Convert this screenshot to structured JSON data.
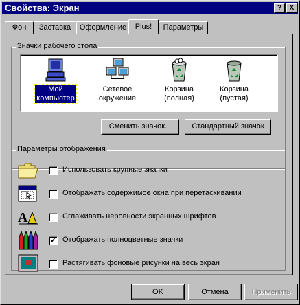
{
  "window": {
    "title": "Свойства: Экран",
    "help_label": "?",
    "close_label": "X"
  },
  "tabs": [
    {
      "label": "Фон"
    },
    {
      "label": "Заставка"
    },
    {
      "label": "Оформление"
    },
    {
      "label": "Plus!"
    },
    {
      "label": "Параметры"
    }
  ],
  "active_tab": "Plus!",
  "desktop_icons": {
    "legend": "Значки рабочего стола",
    "items": [
      {
        "line1": "Мой",
        "line2": "компьютер",
        "icon": "my-computer-icon",
        "selected": true
      },
      {
        "line1": "Сетевое",
        "line2": "окружение",
        "icon": "network-neighborhood-icon",
        "selected": false
      },
      {
        "line1": "Корзина",
        "line2": "(полная)",
        "icon": "recycle-bin-full-icon",
        "selected": false
      },
      {
        "line1": "Корзина",
        "line2": "(пустая)",
        "icon": "recycle-bin-empty-icon",
        "selected": false
      }
    ],
    "change_icon_button": "Сменить значок...",
    "default_icon_button": "Стандартный значок"
  },
  "display": {
    "legend": "Параметры отображения",
    "options": [
      {
        "label": "Использовать крупные значки",
        "checked": false,
        "icon": "folder-icon"
      },
      {
        "label": "Отображать содержимое окна при перетаскивании",
        "checked": false,
        "icon": "window-drag-icon"
      },
      {
        "label": "Сглаживать неровности экранных шрифтов",
        "checked": false,
        "icon": "font-smoothing-icon"
      },
      {
        "label": "Отображать полноцветные значки",
        "checked": true,
        "icon": "crayons-icon"
      },
      {
        "label": "Растягивать фоновые рисунки на весь экран",
        "checked": false,
        "icon": "monitor-wallpaper-icon"
      }
    ]
  },
  "buttons": {
    "ok": "OK",
    "cancel": "Отмена",
    "apply": "Применить"
  },
  "colors": {
    "titlebar": "#000080",
    "face": "#c0c0c0",
    "selection": "#000080"
  }
}
